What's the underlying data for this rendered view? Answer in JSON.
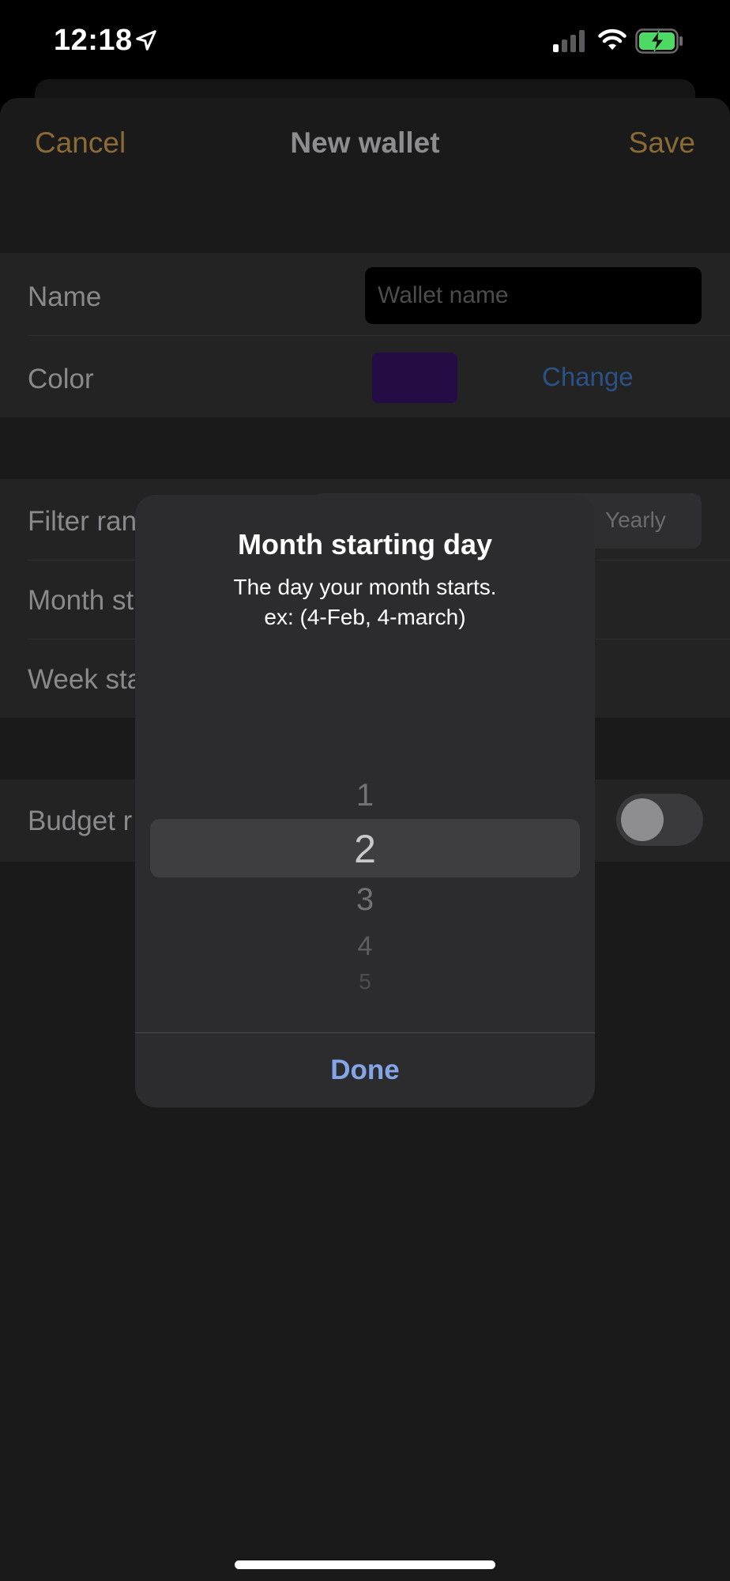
{
  "status_bar": {
    "time": "12:18",
    "location_icon": "location-arrow-icon",
    "signal_icon": "cellular-signal-icon",
    "wifi_icon": "wifi-icon",
    "battery_icon": "battery-charging-icon",
    "battery_color": "#4cd964"
  },
  "nav": {
    "cancel_label": "Cancel",
    "title": "New wallet",
    "save_label": "Save",
    "accent_color": "#8a6a35"
  },
  "form": {
    "name_label": "Name",
    "name_placeholder": "Wallet name",
    "color_label": "Color",
    "color_value": "#250c45",
    "change_label": "Change",
    "filter_label": "Filter ran",
    "filter_selected_visible": "Yearly",
    "month_label": "Month st",
    "week_label": "Week sta",
    "budget_label": "Budget r",
    "budget_toggle_on": false
  },
  "dialog": {
    "title": "Month starting day",
    "message_line1": "The day your month starts.",
    "message_line2": "ex: (4-Feb, 4-march)",
    "picker_items": [
      "1",
      "2",
      "3",
      "4",
      "5"
    ],
    "picker_selected": "2",
    "done_label": "Done"
  }
}
